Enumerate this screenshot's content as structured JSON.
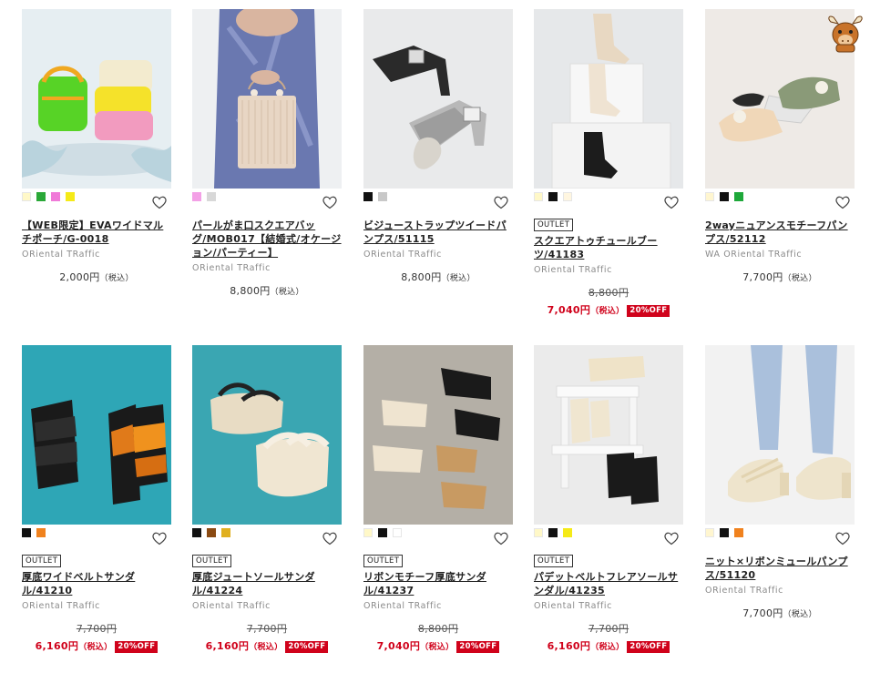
{
  "products": [
    {
      "name": "【WEB限定】EVAワイドマルチポーチ/G-0018",
      "brand": "ORiental TRaffic",
      "price": "2,000円",
      "tax": "（税込）",
      "badge": "",
      "swatches": [
        "#fff8c8",
        "#2aa838",
        "#f07ad8",
        "#f5ea18"
      ],
      "favorite_icon": "heart-outline-icon",
      "image": "colorful-pouches-image"
    },
    {
      "name": "パールがま口スクエアバッグ/MOB017【結婚式/オケージョン/パーティー】",
      "brand": "ORiental TRaffic",
      "price": "8,800円",
      "tax": "（税込）",
      "badge": "",
      "swatches": [
        "#f3a0e6",
        "#d8d8d8"
      ],
      "favorite_icon": "heart-outline-icon",
      "image": "pearl-clutch-bag-image"
    },
    {
      "name": "ビジューストラップツイードパンプス/51115",
      "brand": "ORiental TRaffic",
      "price": "8,800円",
      "tax": "（税込）",
      "badge": "",
      "swatches": [
        "#111111",
        "#c8c8c8"
      ],
      "favorite_icon": "heart-outline-icon",
      "image": "tweed-pumps-image"
    },
    {
      "name": "スクエアトゥチュールブーツ/41183",
      "brand": "ORiental TRaffic",
      "orig_price": "8,800円",
      "sale_price": "7,040円",
      "tax": "（税込）",
      "discount": "20%OFF",
      "badge": "OUTLET",
      "swatches": [
        "#fff8c8",
        "#111111",
        "#fff6e0"
      ],
      "favorite_icon": "heart-outline-icon",
      "image": "tulle-boots-image"
    },
    {
      "name": "2wayニュアンスモチーフパンプス/52112",
      "brand": "WA ORiental TRaffic",
      "price": "7,700円",
      "tax": "（税込）",
      "badge": "",
      "swatches": [
        "#fff6d0",
        "#111111",
        "#1ea83a"
      ],
      "favorite_icon": "heart-outline-icon",
      "image": "pointed-pumps-image"
    },
    {
      "name": "厚底ワイドベルトサンダル/41210",
      "brand": "ORiental TRaffic",
      "orig_price": "7,700円",
      "sale_price": "6,160円",
      "tax": "（税込）",
      "discount": "20%OFF",
      "badge": "OUTLET",
      "swatches": [
        "#111111",
        "#f0821e"
      ],
      "favorite_icon": "heart-outline-icon",
      "image": "wide-belt-sandals-image"
    },
    {
      "name": "厚底ジュートソールサンダル/41224",
      "brand": "ORiental TRaffic",
      "orig_price": "7,700円",
      "sale_price": "6,160円",
      "tax": "（税込）",
      "discount": "20%OFF",
      "badge": "OUTLET",
      "swatches": [
        "#111111",
        "#8a4a12",
        "#e0b020"
      ],
      "favorite_icon": "heart-outline-icon",
      "image": "jute-sole-sandals-image"
    },
    {
      "name": "リボンモチーフ厚底サンダル/41237",
      "brand": "ORiental TRaffic",
      "orig_price": "8,800円",
      "sale_price": "7,040円",
      "tax": "（税込）",
      "discount": "20%OFF",
      "badge": "OUTLET",
      "swatches": [
        "#fff8c8",
        "#111111",
        "#ffffff"
      ],
      "favorite_icon": "heart-outline-icon",
      "image": "ribbon-sandals-image"
    },
    {
      "name": "パデットベルトフレアソールサンダル/41235",
      "brand": "ORiental TRaffic",
      "orig_price": "7,700円",
      "sale_price": "6,160円",
      "tax": "（税込）",
      "discount": "20%OFF",
      "badge": "OUTLET",
      "swatches": [
        "#fff8c8",
        "#111111",
        "#f5ea18"
      ],
      "favorite_icon": "heart-outline-icon",
      "image": "padded-sandals-image"
    },
    {
      "name": "ニット×リボンミュールパンプス/51120",
      "brand": "ORiental TRaffic",
      "price": "7,700円",
      "tax": "（税込）",
      "badge": "",
      "swatches": [
        "#fff6d0",
        "#111111",
        "#f0821e"
      ],
      "favorite_icon": "heart-outline-icon",
      "image": "knit-mule-pumps-image"
    }
  ],
  "mascot": {
    "icon": "bull-mascot-icon"
  }
}
